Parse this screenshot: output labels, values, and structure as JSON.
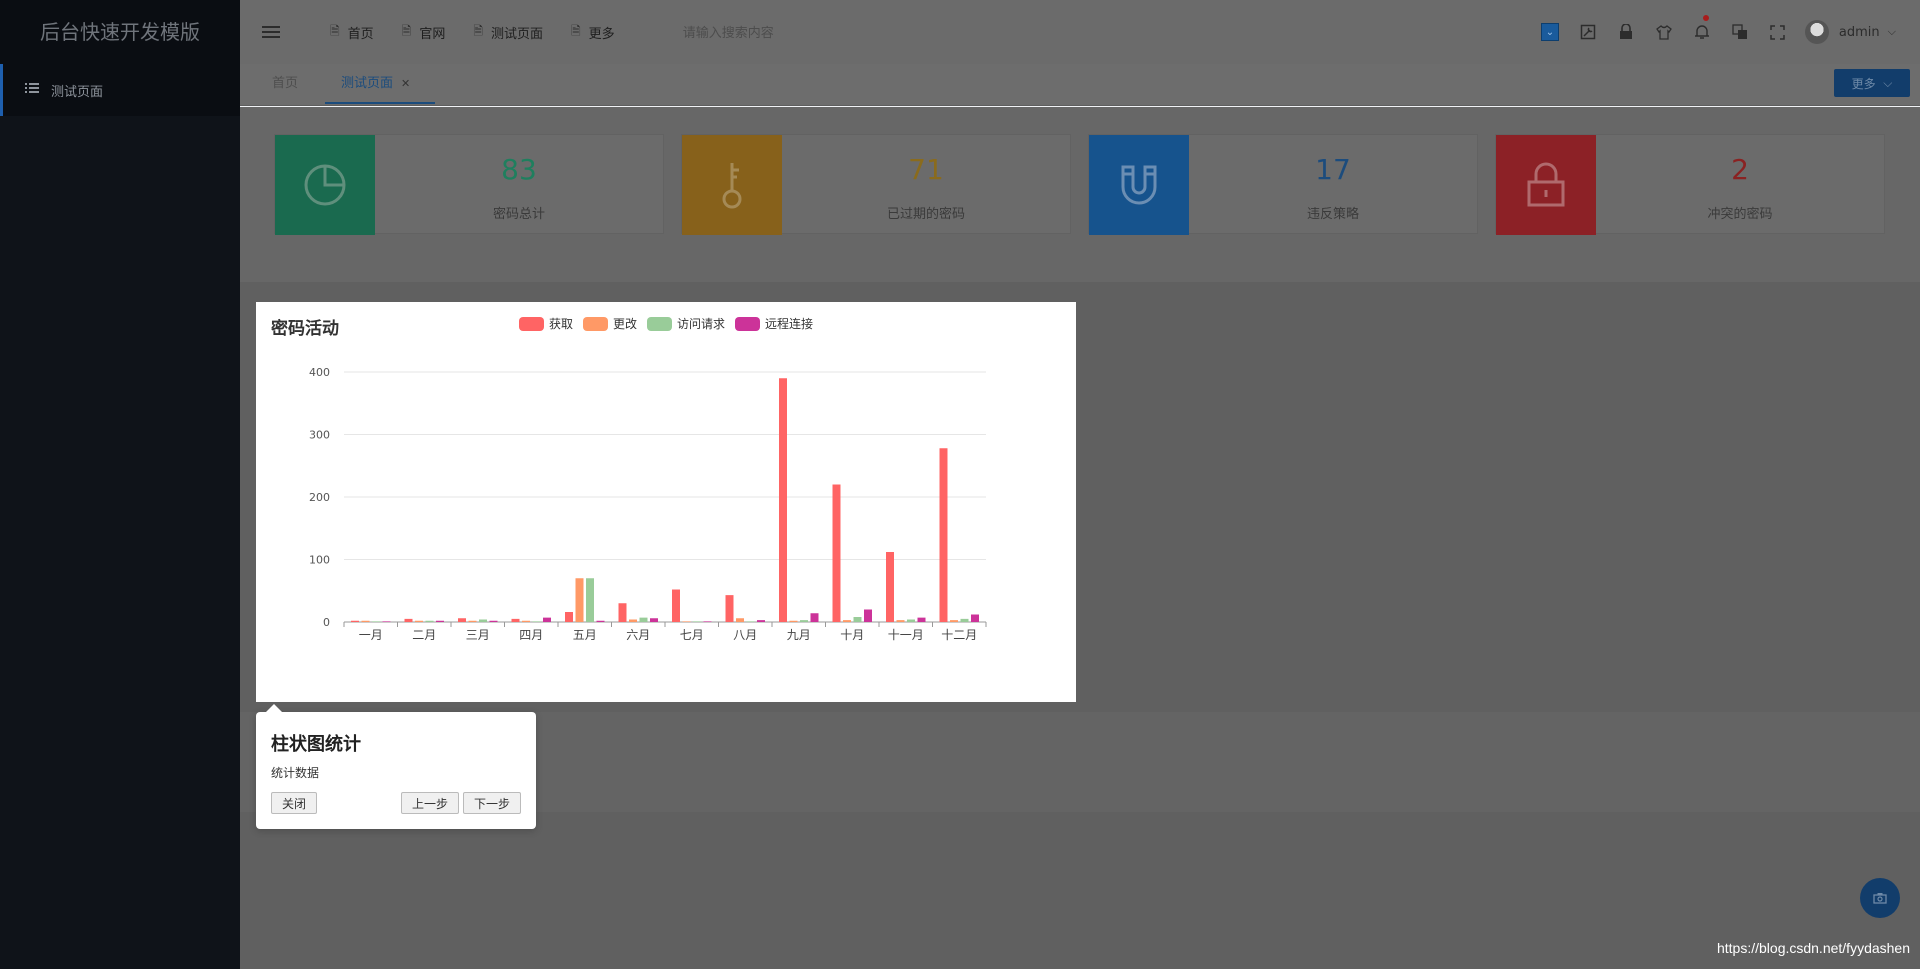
{
  "app": {
    "title": "后台快速开发模版"
  },
  "sidebar": {
    "items": [
      {
        "label": "测试页面"
      }
    ]
  },
  "header": {
    "nav": [
      {
        "label": "首页"
      },
      {
        "label": "官网"
      },
      {
        "label": "测试页面"
      },
      {
        "label": "更多"
      }
    ],
    "search_placeholder": "请输入搜索内容",
    "user": "admin"
  },
  "tabs": {
    "home": "首页",
    "active": "测试页面",
    "more_label": "更多"
  },
  "cards": [
    {
      "value": "83",
      "label": "密码总计",
      "color": "#1f7f5e",
      "value_color": "#1f7f5e",
      "icon": "pie-chart-icon"
    },
    {
      "value": "71",
      "label": "已过期的密码",
      "color": "#b87c1c",
      "value_color": "#8a6b1d",
      "icon": "key-icon"
    },
    {
      "value": "17",
      "label": "违反策略",
      "color": "#1b69b3",
      "value_color": "#1c4c7d",
      "icon": "magnet-icon"
    },
    {
      "value": "2",
      "label": "冲突的密码",
      "color": "#b3262c",
      "value_color": "#8a2222",
      "icon": "lock-icon"
    }
  ],
  "chart_data": {
    "type": "bar",
    "title": "密码活动",
    "categories": [
      "一月",
      "二月",
      "三月",
      "四月",
      "五月",
      "六月",
      "七月",
      "八月",
      "九月",
      "十月",
      "十一月",
      "十二月"
    ],
    "series": [
      {
        "name": "获取",
        "color": "#ff6464",
        "values": [
          2,
          5,
          6,
          5,
          16,
          30,
          52,
          43,
          390,
          220,
          112,
          278
        ]
      },
      {
        "name": "更改",
        "color": "#ff9966",
        "values": [
          2,
          2,
          2,
          2,
          70,
          4,
          1,
          6,
          2,
          3,
          3,
          3
        ]
      },
      {
        "name": "访问请求",
        "color": "#99cc99",
        "values": [
          1,
          2,
          4,
          1,
          70,
          7,
          1,
          1,
          3,
          8,
          4,
          5
        ]
      },
      {
        "name": "远程连接",
        "color": "#cc3399",
        "values": [
          1,
          2,
          2,
          7,
          2,
          6,
          1,
          3,
          14,
          20,
          7,
          12
        ]
      }
    ],
    "ylim": [
      0,
      400
    ],
    "yticks": [
      0,
      100,
      200,
      300,
      400
    ],
    "grid": true,
    "legend": "top"
  },
  "guide": {
    "title": "柱状图统计",
    "desc": "统计数据",
    "close": "关闭",
    "prev": "上一步",
    "next": "下一步"
  },
  "watermark": "https://blog.csdn.net/fyydashen"
}
